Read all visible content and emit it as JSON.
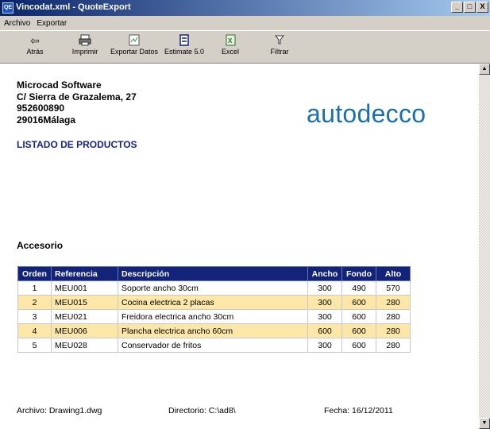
{
  "window": {
    "title": "Vincodat.xml - QuoteExport",
    "app_icon_text": "QE",
    "controls": [
      "_",
      "□",
      "X"
    ]
  },
  "menu": [
    "Archivo",
    "Exportar"
  ],
  "toolbar": [
    {
      "label": "Atrás",
      "icon": "back-arrow-icon"
    },
    {
      "label": "Imprimir",
      "icon": "printer-icon"
    },
    {
      "label": "Exportar Datos",
      "icon": "export-icon"
    },
    {
      "label": "Estimate 5.0",
      "icon": "estimate-icon"
    },
    {
      "label": "Excel",
      "icon": "excel-icon"
    },
    {
      "label": "Filtrar",
      "icon": "filter-icon"
    }
  ],
  "report": {
    "company": {
      "name": "Microcad Software",
      "address": "C/ Sierra de Grazalema, 27",
      "phone": "952600890",
      "city": "29016Málaga"
    },
    "brand": "autodecco",
    "list_title": "LISTADO DE PRODUCTOS",
    "section": "Accesorio",
    "table": {
      "headers": [
        "Orden",
        "Referencia",
        "Descripción",
        "Ancho",
        "Fondo",
        "Alto"
      ],
      "rows": [
        [
          "1",
          "MEU001",
          "Soporte ancho 30cm",
          "300",
          "490",
          "570"
        ],
        [
          "2",
          "MEU015",
          "Cocina electrica 2 placas",
          "300",
          "600",
          "280"
        ],
        [
          "3",
          "MEU021",
          "Freidora electrica ancho 30cm",
          "300",
          "600",
          "280"
        ],
        [
          "4",
          "MEU006",
          "Plancha electrica ancho 60cm",
          "600",
          "600",
          "280"
        ],
        [
          "5",
          "MEU028",
          "Conservador de fritos",
          "300",
          "600",
          "280"
        ]
      ]
    },
    "footer": {
      "archivo": "Archivo: Drawing1.dwg",
      "directorio": "Directorio: C:\\ad8\\",
      "fecha": "Fecha: 16/12/2011"
    }
  },
  "colors": {
    "titlebar_start": "#0a246a",
    "header_bg": "#13237a",
    "alt_row_bg": "#fde7a8",
    "brand": "#1a6fae"
  }
}
